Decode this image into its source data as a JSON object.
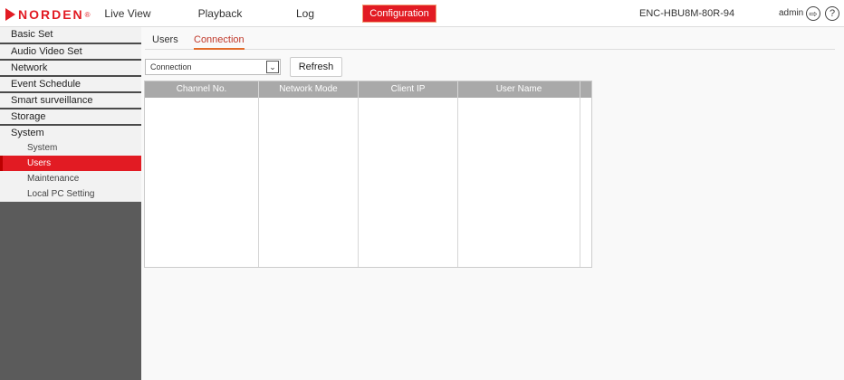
{
  "brand": {
    "logo_text": "NORDEN",
    "logo_mark": "®"
  },
  "nav": {
    "items": [
      {
        "label": "Live View"
      },
      {
        "label": "Playback"
      },
      {
        "label": "Log"
      },
      {
        "label": "Configuration",
        "active": true
      }
    ]
  },
  "header": {
    "device_name": "ENC-HBU8M-80R-94",
    "user": "admin",
    "logout_glyph": "⇨",
    "help_glyph": "?"
  },
  "sidebar": {
    "categories": [
      {
        "label": "Basic Set"
      },
      {
        "label": "Audio Video Set"
      },
      {
        "label": "Network"
      },
      {
        "label": "Event Schedule"
      },
      {
        "label": "Smart surveillance"
      },
      {
        "label": "Storage"
      },
      {
        "label": "System"
      }
    ],
    "system_items": [
      {
        "label": "System"
      },
      {
        "label": "Users",
        "active": true
      },
      {
        "label": "Maintenance"
      },
      {
        "label": "Local PC Setting"
      }
    ]
  },
  "tabs": [
    {
      "label": "Users"
    },
    {
      "label": "Connection",
      "active": true
    }
  ],
  "toolbar": {
    "select_value": "Connection",
    "select_arrow_glyph": "⌄",
    "refresh_label": "Refresh"
  },
  "table": {
    "columns": [
      "Channel No.",
      "Network Mode",
      "Client IP",
      "User Name"
    ],
    "rows": []
  },
  "colors": {
    "accent": "#e21b23",
    "header_bg": "#a9a9a9",
    "sidebar_bg": "#5b5b5b"
  }
}
